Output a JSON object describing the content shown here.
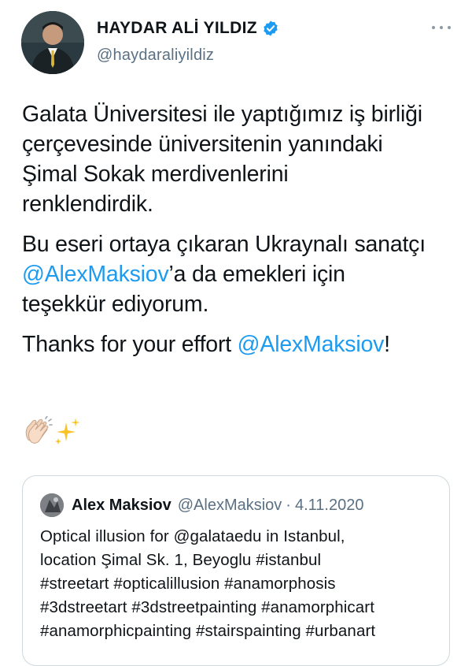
{
  "tweet": {
    "author": {
      "display_name": "HAYDAR ALİ YILDIZ",
      "handle": "@haydaraliyildiz",
      "verified": true
    },
    "more_options": "more-icon",
    "paragraphs": {
      "p1": {
        "line1": "Galata Üniversitesi ile yaptığımız iş birliği",
        "line2": "çerçevesinde üniversitenin yanındaki",
        "line3": "Şimal Sokak merdivenlerini",
        "line4": "renklendirdik."
      },
      "p2": {
        "line1": "Bu eseri ortaya çıkaran Ukraynalı sanatçı",
        "mention": "@AlexMaksiov",
        "line2_rest": "’a da emekleri için",
        "line3": "teşekkür ediyorum."
      },
      "p3": {
        "prefix": "Thanks for your effort ",
        "mention": "@AlexMaksiov",
        "suffix": "!"
      }
    },
    "emojis": [
      "clapping-hands-emoji",
      "sparkles-emoji"
    ]
  },
  "quoted_tweet": {
    "display_name": "Alex Maksiov",
    "handle": "@AlexMaksiov",
    "separator": "·",
    "date": "4.11.2020",
    "lines": {
      "l1": "Optical illusion for @galataedu in Istanbul,",
      "l2": "location Şimal Sk. 1, Beyoglu  #istanbul",
      "l3": "#streetart #opticalillusion #anamorphosis",
      "l4": "#3dstreetart #3dstreetpainting #anamorphicart",
      "l5": "#anamorphicpainting #stairspainting #urbanart"
    }
  },
  "colors": {
    "text": "#0f1419",
    "secondary": "#5b7083",
    "link": "#1d9bf0",
    "verified": "#1d9bf0",
    "border": "#cfd9de"
  }
}
